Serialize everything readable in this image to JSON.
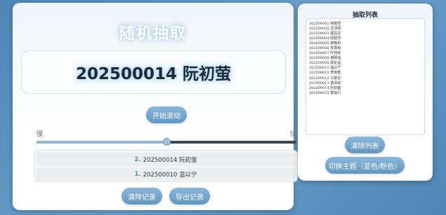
{
  "main": {
    "title": "随机抽取",
    "current_display": "202500014 阮初萤",
    "start_button": "开始滚动",
    "speed": {
      "slow_label": "慢",
      "fast_label": "快",
      "level": 0.5
    },
    "history": [
      {
        "index": "2.",
        "text": "202500014 阮初萤"
      },
      {
        "index": "1.",
        "text": "202500010 温以宁"
      }
    ],
    "clear_records_button": "清除记录",
    "export_records_button": "导出记录"
  },
  "side": {
    "title": "抽取列表",
    "list": [
      "202500001 林若妤",
      "202500002 沈沐晴",
      "202500003 程昱言",
      "202500004 陆昭然",
      "202500005 柳晚舟",
      "202500006 苏霆和",
      "202500007 叶知秋",
      "202500008 谢明溪",
      "202500009 顾星遥",
      "202500010 温以宁",
      "202500011 贺南笙",
      "202500012 江景云",
      "202500013 裴清欢",
      "202500014 阮初萤",
      "202500015 季临川"
    ],
    "clear_list_button": "清除列表",
    "toggle_theme_button": "切换主题（蓝色/粉色）"
  },
  "colors": {
    "accent": "#6a9ec8",
    "background": "#5b91be",
    "history_index": "#4a90d0"
  }
}
